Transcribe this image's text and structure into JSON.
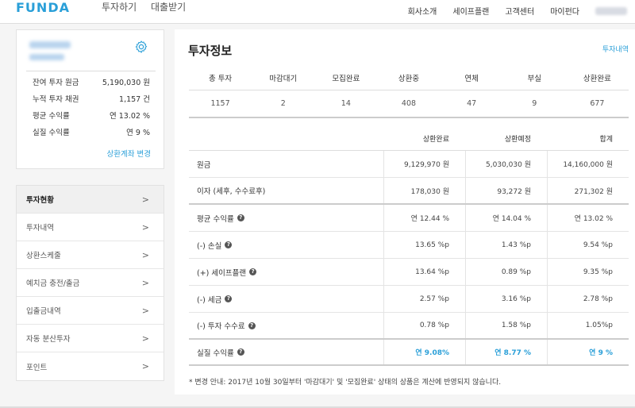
{
  "header": {
    "logo": "FUNDA",
    "nav_main": [
      "투자하기",
      "대출받기"
    ],
    "nav_right": [
      "회사소개",
      "세이프플랜",
      "고객센터",
      "마이펀다"
    ]
  },
  "profile": {
    "rows": [
      {
        "label": "잔여 투자 원금",
        "value": "5,190,030 원"
      },
      {
        "label": "누적 투자 채권",
        "value": "1,157 건"
      },
      {
        "label": "평균 수익률",
        "value": "연 13.02 %"
      },
      {
        "label": "실질 수익률",
        "value": "연 9 %"
      }
    ],
    "link": "상환계좌 변경"
  },
  "menu": {
    "items": [
      {
        "label": "투자현황"
      },
      {
        "label": "투자내역"
      },
      {
        "label": "상환스케줄"
      },
      {
        "label": "예치금 충전/출금"
      },
      {
        "label": "입출금내역"
      },
      {
        "label": "자동 분산투자"
      },
      {
        "label": "포인트"
      }
    ],
    "chevron": ">"
  },
  "main": {
    "title": "투자정보",
    "title_link": "투자내역",
    "stats_headers": [
      "총 투자",
      "마감대기",
      "모집완료",
      "상환중",
      "연체",
      "부실",
      "상환완료"
    ],
    "stats_values": [
      "1157",
      "2",
      "14",
      "408",
      "47",
      "9",
      "677"
    ],
    "table_headers": [
      "상환완료",
      "상환예정",
      "합계"
    ],
    "table_rows": [
      {
        "label": "원금",
        "values": [
          "9,129,970 원",
          "5,030,030 원",
          "14,160,000 원"
        ]
      },
      {
        "label": "이자 (세후, 수수료후)",
        "values": [
          "178,030 원",
          "93,272 원",
          "271,302 원"
        ]
      },
      {
        "label": "평균 수익률",
        "values": [
          "연 12.44 %",
          "연 14.04 %",
          "연 13.02 %"
        ]
      },
      {
        "label": "(-) 손실",
        "values": [
          "13.65 %p",
          "1.43 %p",
          "9.54 %p"
        ]
      },
      {
        "label": "(+) 세이프플랜",
        "values": [
          "13.64 %p",
          "0.89 %p",
          "9.35 %p"
        ]
      },
      {
        "label": "(-) 세금",
        "values": [
          "2.57 %p",
          "3.16 %p",
          "2.78 %p"
        ]
      },
      {
        "label": "(-) 투자 수수료",
        "values": [
          "0.78 %p",
          "1.58 %p",
          "1.05%p"
        ]
      }
    ],
    "total_row": {
      "label": "실질 수익률",
      "values": [
        "연 9.08%",
        "연 8.77 %",
        "연 9 %"
      ]
    },
    "question_mark": "?",
    "note": "* 변경 안내: 2017년 10월 30일부터 '마감대기' 및 '모집완료' 상태의 상품은 계산에 반영되지 않습니다."
  }
}
